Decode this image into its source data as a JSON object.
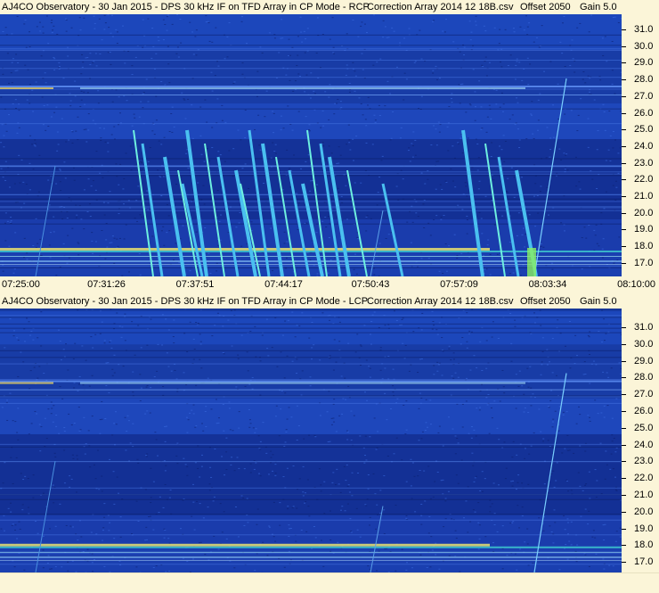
{
  "top_panel": {
    "title_left": "AJ4CO Observatory - 30 Jan 2015 - DPS 30 kHz IF on TFD Array in CP Mode - RCP",
    "title_file": "Correction Array 2014 12 18B.csv",
    "title_offset": "Offset 2050",
    "title_gain": "Gain 5.0"
  },
  "bottom_panel": {
    "title_left": "AJ4CO Observatory - 30 Jan 2015 - DPS 30 kHz IF on TFD Array in CP Mode - LCP",
    "title_file": "Correction Array 2014 12 18B.csv",
    "title_offset": "Offset 2050",
    "title_gain": "Gain 5.0"
  },
  "y_axis_labels": [
    "31.0",
    "30.0",
    "29.0",
    "28.0",
    "27.0",
    "26.0",
    "25.0",
    "24.0",
    "23.0",
    "22.0",
    "21.0",
    "20.0",
    "19.0",
    "18.0",
    "17.0"
  ],
  "x_axis_labels": [
    "07:25:00",
    "07:31:26",
    "07:37:51",
    "07:44:17",
    "07:50:43",
    "07:57:09",
    "08:03:34",
    "08:10:00"
  ],
  "colors": {
    "background_base": "#1a3fb0",
    "band_yellow": "#e8e070",
    "band_cyan": "#40d0d0",
    "axis_bg": "#fbf5d8"
  }
}
